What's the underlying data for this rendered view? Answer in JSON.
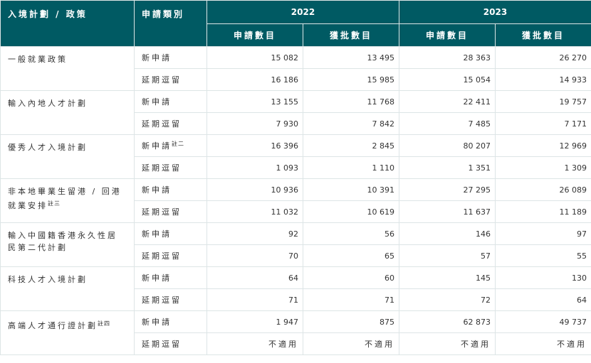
{
  "header": {
    "policy": "入境計劃 / 政策",
    "category": "申請類別",
    "year_a": "2022",
    "year_b": "2023",
    "applications": "申請數目",
    "approved": "獲批數目"
  },
  "rows": [
    {
      "policy": "一般就業政策",
      "note": "",
      "new": {
        "cat": "新申請",
        "note": "",
        "v": [
          "15 082",
          "13 495",
          "28 363",
          "26 270"
        ]
      },
      "ext": {
        "cat": "延期逗留",
        "v": [
          "16 186",
          "15 985",
          "15 054",
          "14 933"
        ]
      }
    },
    {
      "policy": "輸入內地人才計劃",
      "note": "",
      "new": {
        "cat": "新申請",
        "note": "",
        "v": [
          "13 155",
          "11 768",
          "22 411",
          "19 757"
        ]
      },
      "ext": {
        "cat": "延期逗留",
        "v": [
          "7 930",
          "7 842",
          "7 485",
          "7 171"
        ]
      }
    },
    {
      "policy": "優秀人才入境計劃",
      "note": "",
      "new": {
        "cat": "新申請",
        "note": "註二",
        "v": [
          "16 396",
          "2 845",
          "80 207",
          "12 969"
        ]
      },
      "ext": {
        "cat": "延期逗留",
        "v": [
          "1 093",
          "1 110",
          "1 351",
          "1 309"
        ]
      }
    },
    {
      "policy": "非本地畢業生留港 / 回港就業安排",
      "note": "註三",
      "new": {
        "cat": "新申請",
        "note": "",
        "v": [
          "10 936",
          "10 391",
          "27 295",
          "26 089"
        ]
      },
      "ext": {
        "cat": "延期逗留",
        "v": [
          "11 032",
          "10 619",
          "11 637",
          "11 189"
        ]
      }
    },
    {
      "policy": "輸入中國籍香港永久性居民第二代計劃",
      "note": "",
      "new": {
        "cat": "新申請",
        "note": "",
        "v": [
          "92",
          "56",
          "146",
          "97"
        ]
      },
      "ext": {
        "cat": "延期逗留",
        "v": [
          "70",
          "65",
          "57",
          "55"
        ]
      }
    },
    {
      "policy": "科技人才入境計劃",
      "note": "",
      "new": {
        "cat": "新申請",
        "note": "",
        "v": [
          "64",
          "60",
          "145",
          "130"
        ]
      },
      "ext": {
        "cat": "延期逗留",
        "v": [
          "71",
          "71",
          "72",
          "64"
        ]
      }
    },
    {
      "policy": "高端人才通行證計劃",
      "note": "註四",
      "new": {
        "cat": "新申請",
        "note": "",
        "v": [
          "1 947",
          "875",
          "62 873",
          "49 737"
        ]
      },
      "ext": {
        "cat": "延期逗留",
        "v": [
          "不適用",
          "不適用",
          "不適用",
          "不適用"
        ]
      }
    }
  ]
}
